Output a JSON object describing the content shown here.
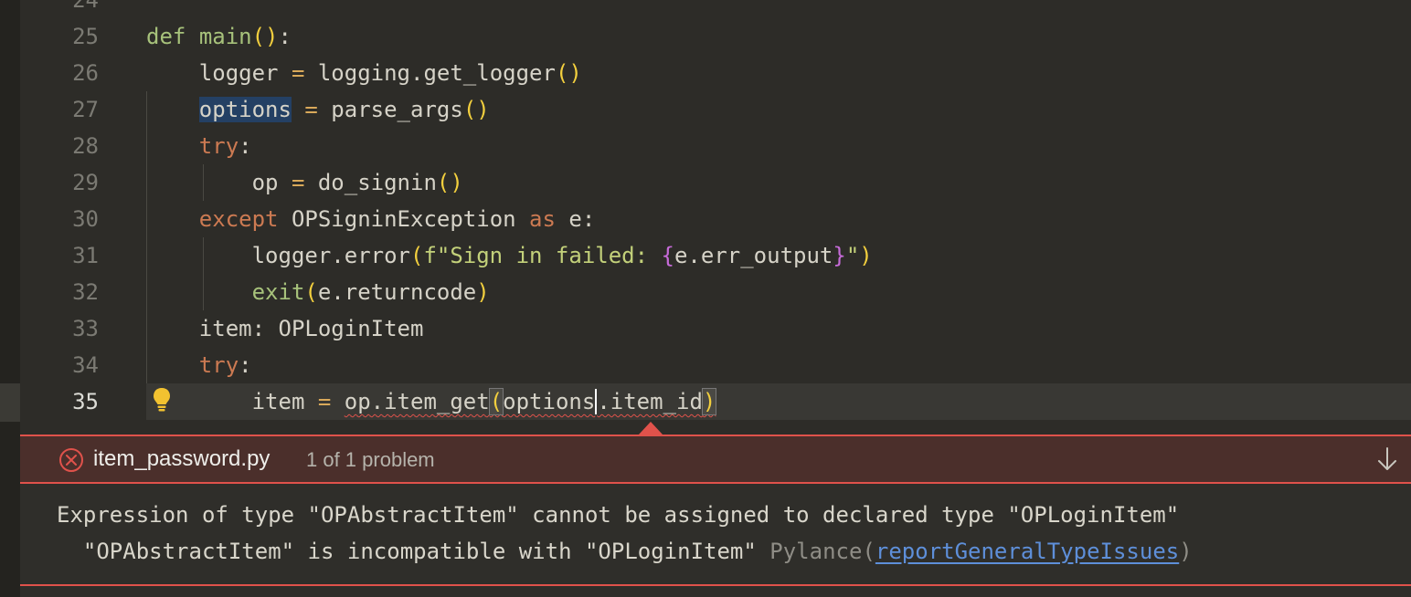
{
  "editor": {
    "partial_top_line": "24",
    "lines": [
      {
        "num": "25",
        "code": "def main():"
      },
      {
        "num": "26",
        "code": "logger = logging.get_logger()"
      },
      {
        "num": "27",
        "code": "options = parse_args()"
      },
      {
        "num": "28",
        "code": "try:"
      },
      {
        "num": "29",
        "code": "op = do_signin()"
      },
      {
        "num": "30",
        "code": "except OPSigninException as e:"
      },
      {
        "num": "31",
        "code": "logger.error(f\"Sign in failed: {e.err_output}\")"
      },
      {
        "num": "32",
        "code": "exit(e.returncode)"
      },
      {
        "num": "33",
        "code": "item: OPLoginItem"
      },
      {
        "num": "34",
        "code": "try:"
      },
      {
        "num": "35",
        "code": "item = op.item_get(options.item_id)"
      }
    ],
    "current_line": "35",
    "quick_fix_icon": "lightbulb-icon"
  },
  "problem_panel": {
    "icon": "error-circle-icon",
    "file_name": "item_password.py",
    "count_text": "1 of 1 problem",
    "message_line1": "Expression of type \"OPAbstractItem\" cannot be assigned to declared type \"OPLoginItem\"",
    "message_line2": "\"OPAbstractItem\" is incompatible with \"OPLoginItem\"",
    "source": "Pylance",
    "rule": "reportGeneralTypeIssues",
    "next_icon": "arrow-down-icon"
  },
  "colors": {
    "background": "#2d2c28",
    "error": "#e0524b",
    "panel_header": "#4b2f2b",
    "keyword": "#cc7a52",
    "function": "#a7c27b",
    "link": "#5e8fd9"
  }
}
